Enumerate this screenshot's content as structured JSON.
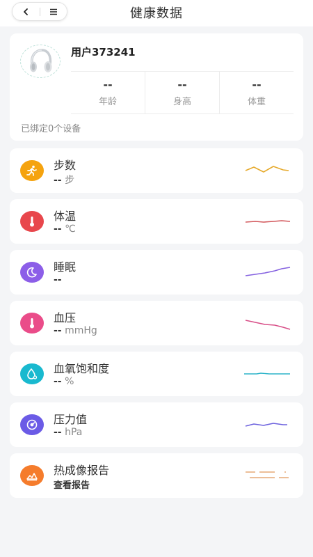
{
  "header": {
    "title": "健康数据",
    "back_icon": "chevron-left-icon",
    "menu_icon": "hamburger-menu-icon"
  },
  "profile": {
    "username": "用户373241",
    "avatar": "headphones-image",
    "stats": [
      {
        "value": "--",
        "label": "年龄"
      },
      {
        "value": "--",
        "label": "身高"
      },
      {
        "value": "--",
        "label": "体重"
      }
    ],
    "device_text": "已绑定0个设备"
  },
  "metrics": [
    {
      "name": "步数",
      "value": "--",
      "unit": "步",
      "icon": "running-icon",
      "color": "#f5a30f"
    },
    {
      "name": "体温",
      "value": "--",
      "unit": "℃",
      "icon": "thermometer-icon",
      "color": "#e8474c"
    },
    {
      "name": "睡眠",
      "value": "--",
      "unit": "",
      "icon": "moon-icon",
      "color": "#8c5ee8"
    },
    {
      "name": "血压",
      "value": "--",
      "unit": "mmHg",
      "icon": "thermometer-icon",
      "color": "#ea4c89"
    },
    {
      "name": "血氧饱和度",
      "value": "--",
      "unit": "%",
      "icon": "droplet-icon",
      "color": "#19b9cf"
    },
    {
      "name": "压力值",
      "value": "--",
      "unit": "hPa",
      "icon": "gauge-icon",
      "color": "#6b5be6"
    },
    {
      "name": "热成像报告",
      "value": "查看报告",
      "unit": "",
      "icon": "thermal-image-icon",
      "color": "#f57c2c"
    }
  ]
}
